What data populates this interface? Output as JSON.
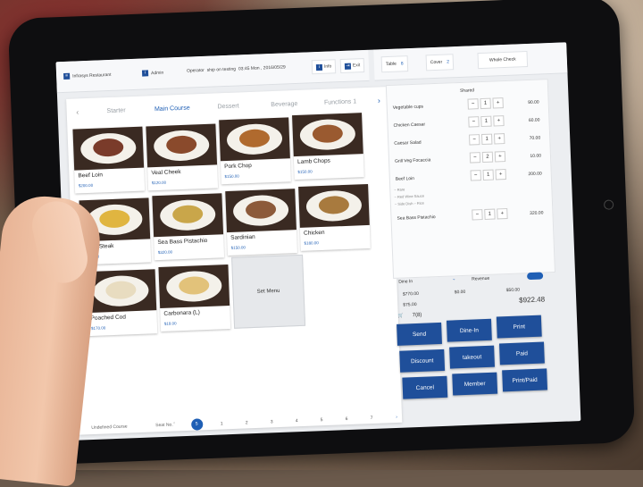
{
  "header": {
    "restaurant": "Infrasys Restaurant",
    "user": "Admin",
    "operator": "Operator",
    "station": "ship on testing",
    "datetime": "03:45 Mon , 2016/05/29",
    "info": "Info",
    "exit": "Exit"
  },
  "right_header": {
    "table_label": "Table",
    "table_value": "8",
    "covers_label": "Cover",
    "covers_value": "2",
    "whole_check": "Whole Check"
  },
  "categories": [
    "Starter",
    "Main Course",
    "Dessert",
    "Beverage",
    "Functions 1"
  ],
  "active_category": "Main Course",
  "menu_items": [
    {
      "name": "Beef Loin",
      "price": "$200.00"
    },
    {
      "name": "Veal Cheek",
      "price": "$120.00"
    },
    {
      "name": "Pork Chop",
      "price": "$150.00"
    },
    {
      "name": "Lamb Chops",
      "price": "$150.00"
    },
    {
      "name": "Tuna Steak",
      "price": "$220.00"
    },
    {
      "name": "Sea Bass Pistachio",
      "price": "$320.00"
    },
    {
      "name": "Sardinian",
      "price": "$150.00"
    },
    {
      "name": "Chicken",
      "price": "$180.00"
    },
    {
      "name": "Poached Cod",
      "price": "$170.00"
    },
    {
      "name": "Carbonara (L)",
      "price": "$19.00"
    }
  ],
  "set_menu": "Set Menu",
  "footer": {
    "undefined_course": "Undefined Course",
    "seat_no": "Seat No.",
    "pages": [
      "5",
      "1",
      "2",
      "3",
      "4",
      "5",
      "6",
      "7"
    ],
    "current_page": "5"
  },
  "order": {
    "section": "Shared",
    "lines": [
      {
        "name": "Vegetable cups",
        "qty": "1",
        "price": "90.00"
      },
      {
        "name": "Chicken Caesar",
        "qty": "1",
        "price": "60.00"
      },
      {
        "name": "Caesar Salad",
        "qty": "1",
        "price": "70.00"
      },
      {
        "name": "Grill Veg Focaccia",
        "qty": "2",
        "price": "10.00"
      },
      {
        "name": "Beef Loin",
        "qty": "1",
        "price": "200.00"
      },
      {
        "name": "Sea Bass Pistachio",
        "qty": "1",
        "price": "320.00"
      }
    ],
    "beef_mods": [
      "– Rare",
      "– Red Wine Sauce",
      "– Side Dish – Rice"
    ]
  },
  "payment": {
    "dine_in": "Dine In",
    "revenue": "Revenue",
    "amounts": [
      "$770.00",
      "$0.00",
      "$50.00",
      "$75.00"
    ],
    "total": "$922.48",
    "guest": "7(8)"
  },
  "actions": [
    "Send",
    "Dine-In",
    "Print",
    "Discount",
    "takeout",
    "Paid",
    "Cancel",
    "Member",
    "Print/Paid"
  ],
  "colors": {
    "accent": "#1f4f9a",
    "link": "#1f5fb5"
  }
}
